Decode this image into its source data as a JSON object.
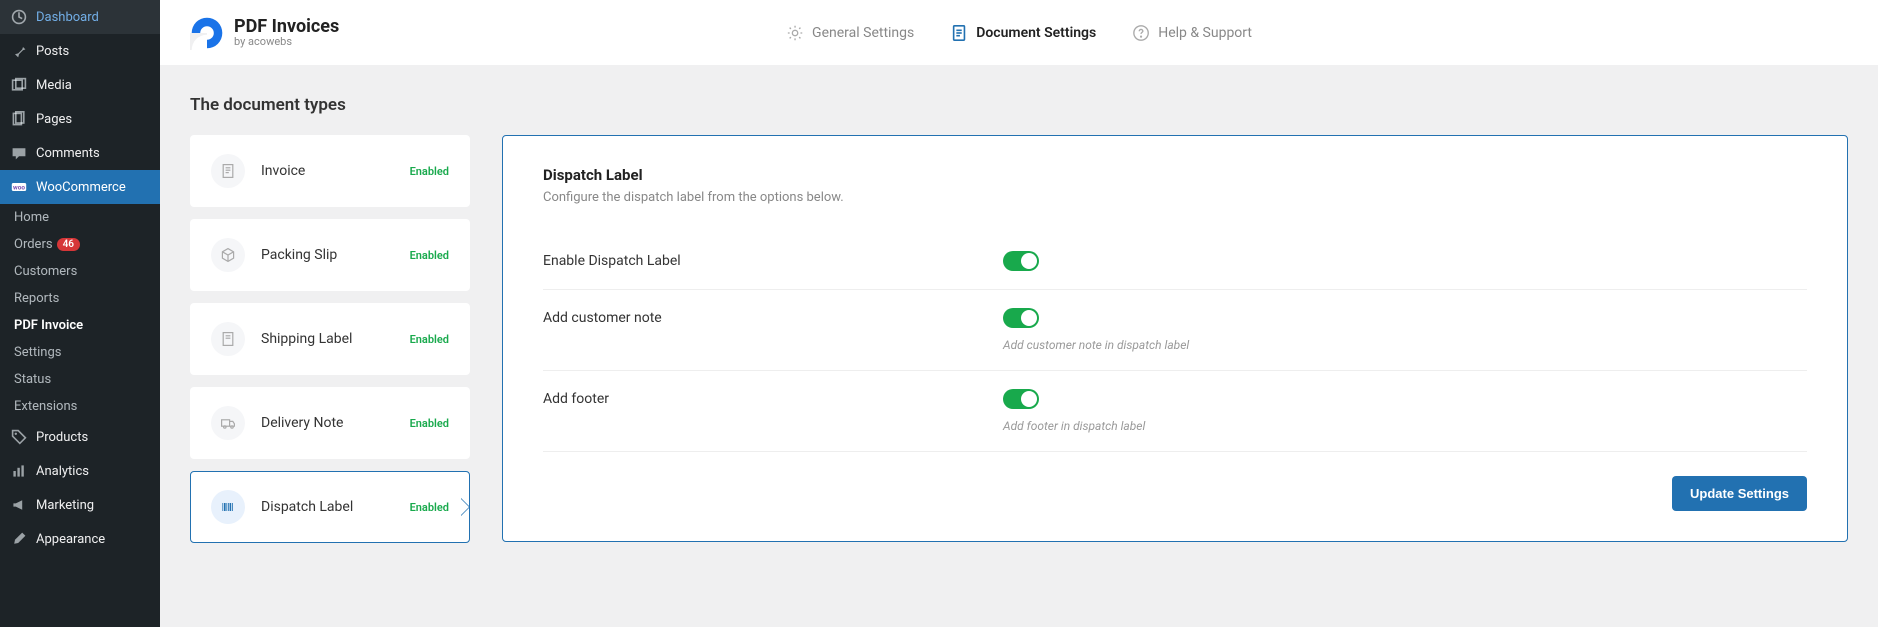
{
  "sidebar": {
    "items": [
      {
        "label": "Dashboard",
        "icon": "dashboard"
      },
      {
        "label": "Posts",
        "icon": "pin"
      },
      {
        "label": "Media",
        "icon": "media"
      },
      {
        "label": "Pages",
        "icon": "pages"
      },
      {
        "label": "Comments",
        "icon": "comment"
      },
      {
        "label": "WooCommerce",
        "icon": "woo",
        "active": true
      },
      {
        "label": "Products",
        "icon": "tag"
      },
      {
        "label": "Analytics",
        "icon": "analytics"
      },
      {
        "label": "Marketing",
        "icon": "megaphone"
      },
      {
        "label": "Appearance",
        "icon": "brush"
      }
    ],
    "subitems": [
      {
        "label": "Home"
      },
      {
        "label": "Orders",
        "badge": "46"
      },
      {
        "label": "Customers"
      },
      {
        "label": "Reports"
      },
      {
        "label": "PDF Invoice",
        "active": true
      },
      {
        "label": "Settings"
      },
      {
        "label": "Status"
      },
      {
        "label": "Extensions"
      }
    ]
  },
  "header": {
    "logo_title": "PDF Invoices",
    "logo_sub": "by acowebs",
    "tabs": [
      {
        "label": "General Settings"
      },
      {
        "label": "Document Settings",
        "active": true
      },
      {
        "label": "Help & Support"
      }
    ]
  },
  "section_title": "The document types",
  "doc_types": [
    {
      "label": "Invoice",
      "status": "Enabled"
    },
    {
      "label": "Packing Slip",
      "status": "Enabled"
    },
    {
      "label": "Shipping Label",
      "status": "Enabled"
    },
    {
      "label": "Delivery Note",
      "status": "Enabled"
    },
    {
      "label": "Dispatch Label",
      "status": "Enabled",
      "selected": true
    }
  ],
  "panel": {
    "title": "Dispatch Label",
    "subtitle": "Configure the dispatch label from the options below.",
    "rows": [
      {
        "label": "Enable Dispatch Label",
        "help": ""
      },
      {
        "label": "Add customer note",
        "help": "Add customer note in dispatch label"
      },
      {
        "label": "Add footer",
        "help": "Add footer in dispatch label"
      }
    ],
    "button": "Update Settings"
  }
}
